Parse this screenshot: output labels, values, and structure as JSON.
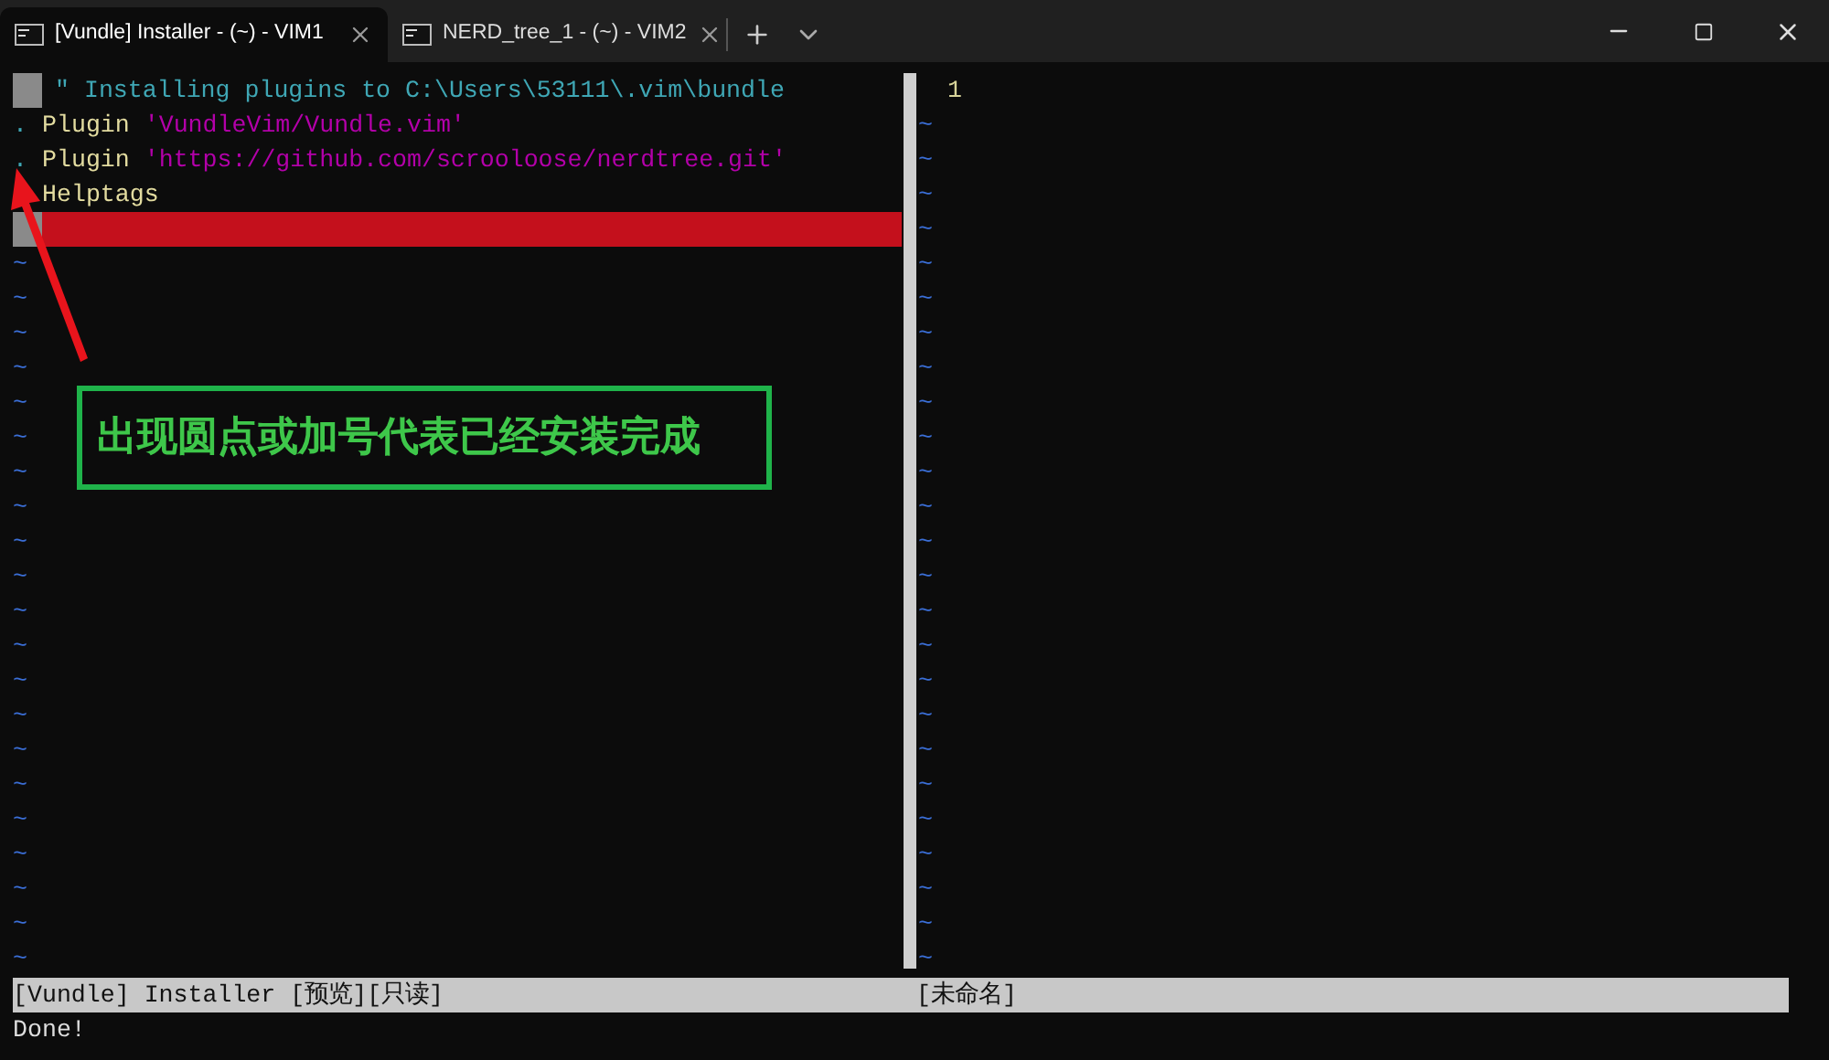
{
  "tabs": [
    {
      "label": "[Vundle] Installer - (~) - VIM1",
      "selected": true
    },
    {
      "label": "NERD_tree_1 - (~) - VIM2",
      "selected": false
    }
  ],
  "left_pane": {
    "lines": [
      {
        "kind": "cursor",
        "segments": [
          {
            "kind": "comment",
            "text": "\" Installing plugins to C:\\Users\\53111\\.vim\\bundle"
          }
        ]
      },
      {
        "marker": ".",
        "segments": [
          {
            "kind": "keyword",
            "text": "Plugin "
          },
          {
            "kind": "string",
            "text": "'VundleVim/Vundle.vim'"
          }
        ]
      },
      {
        "marker": ".",
        "segments": [
          {
            "kind": "keyword",
            "text": "Plugin "
          },
          {
            "kind": "string",
            "text": "'https://github.com/scrooloose/nerdtree.git'"
          }
        ]
      },
      {
        "kind": "plain",
        "segments": [
          {
            "kind": "keyword",
            "text": "Helptags"
          }
        ]
      },
      {
        "kind": "cursor",
        "highlighted": true
      }
    ],
    "empty_lines": [
      "~",
      "~",
      "~",
      "~",
      "~",
      "~",
      "~",
      "~",
      "~",
      "~",
      "~",
      "~",
      "~",
      "~",
      "~",
      "~",
      "~",
      "~",
      "~",
      "~",
      "~"
    ],
    "status": "[Vundle] Installer [预览][只读]"
  },
  "right_pane": {
    "line_number": "1",
    "empty_lines": [
      "~",
      "~",
      "~",
      "~",
      "~",
      "~",
      "~",
      "~",
      "~",
      "~",
      "~",
      "~",
      "~",
      "~",
      "~",
      "~",
      "~",
      "~",
      "~",
      "~",
      "~",
      "~",
      "~",
      "~",
      "~"
    ],
    "status": "[未命名]"
  },
  "message": "Done!",
  "annotation": {
    "text": "出现圆点或加号代表已经安装完成"
  }
}
